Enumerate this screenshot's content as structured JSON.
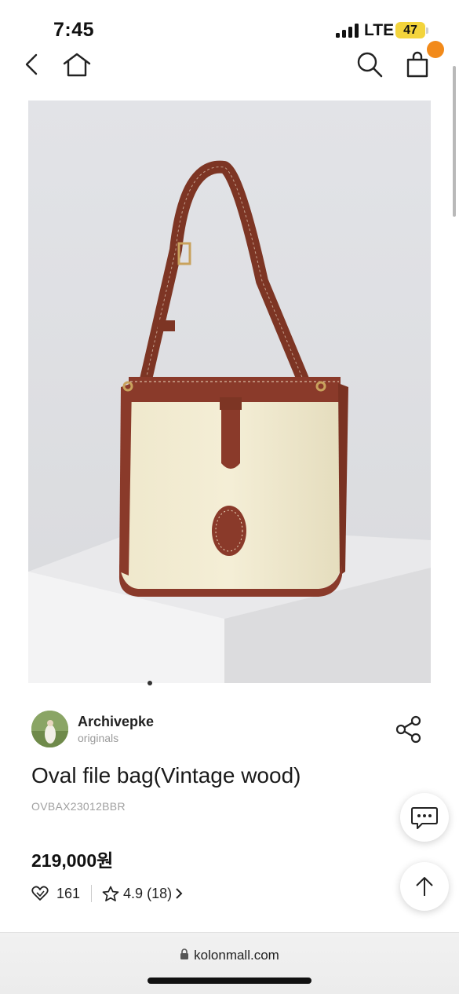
{
  "status_bar": {
    "time": "7:45",
    "network": "LTE",
    "battery": "47"
  },
  "nav": {
    "back_icon": "chevron-left-icon",
    "home_icon": "home-icon",
    "search_icon": "search-icon",
    "cart_icon": "shopping-bag-icon"
  },
  "product": {
    "brand_name": "Archivepke",
    "brand_sub": "originals",
    "title": "Oval file bag(Vintage wood)",
    "code": "OVBAX23012BBR",
    "price": "219,000원",
    "likes": "161",
    "rating": "4.9",
    "review_count": "(18)"
  },
  "browser": {
    "url": "kolonmall.com"
  },
  "colors": {
    "cart_badge": "#f28a1a",
    "battery": "#f3d43c",
    "leather": "#8a3a2a",
    "canvas": "#f2ecd2"
  }
}
